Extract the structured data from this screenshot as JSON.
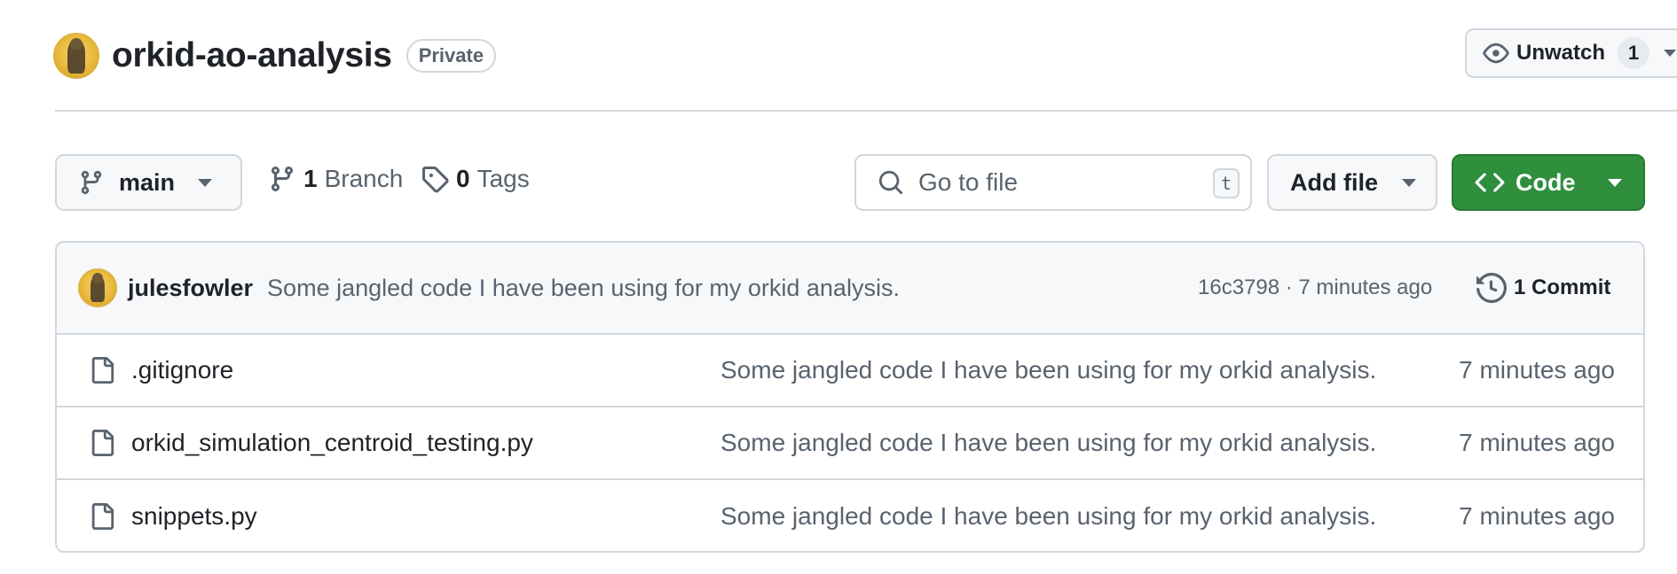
{
  "repo": {
    "name": "orkid-ao-analysis",
    "visibility": "Private"
  },
  "watch": {
    "label": "Unwatch",
    "count": "1"
  },
  "toolbar": {
    "branch": "main",
    "branches_count": "1",
    "branches_label": "Branch",
    "tags_count": "0",
    "tags_label": "Tags",
    "search_placeholder": "Go to file",
    "search_shortcut": "t",
    "add_file_label": "Add file",
    "code_label": "Code"
  },
  "latest_commit": {
    "author": "julesfowler",
    "message": "Some jangled code I have been using for my orkid analysis.",
    "meta": "16c3798 · 7 minutes ago",
    "commits_label": "1 Commit"
  },
  "files": [
    {
      "name": ".gitignore",
      "message": "Some jangled code I have been using for my orkid analysis.",
      "age": "7 minutes ago"
    },
    {
      "name": "orkid_simulation_centroid_testing.py",
      "message": "Some jangled code I have been using for my orkid analysis.",
      "age": "7 minutes ago"
    },
    {
      "name": "snippets.py",
      "message": "Some jangled code I have been using for my orkid analysis.",
      "age": "7 minutes ago"
    }
  ],
  "icons": {
    "watch": "eye-icon",
    "branch": "git-branch-icon",
    "tag": "tag-icon",
    "search": "search-icon",
    "code": "code-icon",
    "history": "history-icon",
    "file": "file-icon"
  },
  "colors": {
    "code_button": "#2f8f3d",
    "border": "#d0d7de",
    "muted_text": "#59636e"
  }
}
